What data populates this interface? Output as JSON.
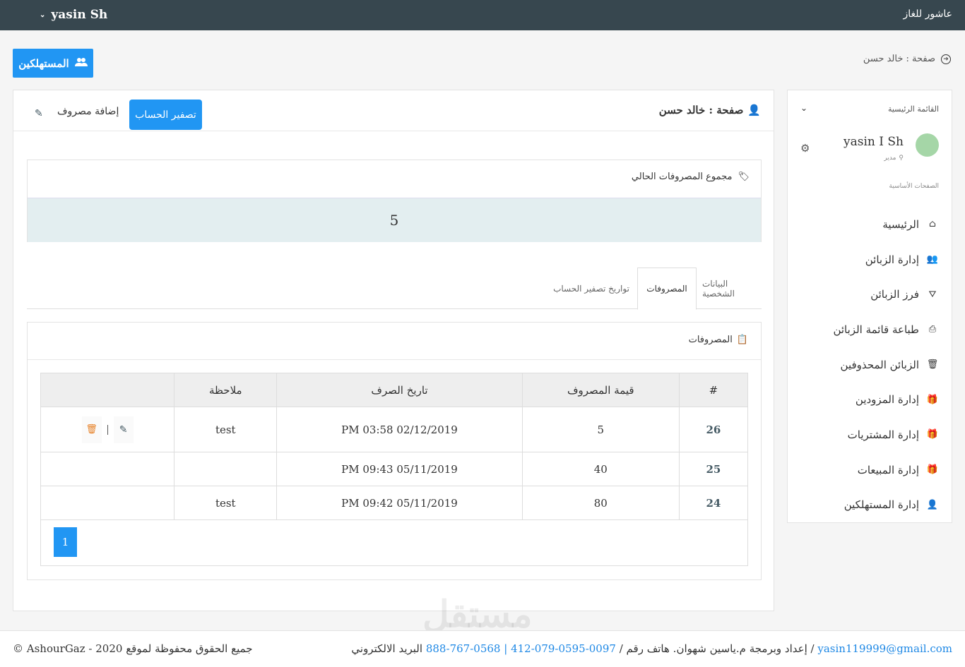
{
  "topbar": {
    "brand": "عاشور للغاز",
    "user": "yasin Sh"
  },
  "page": {
    "crumb": "صفحة : خالد حسن",
    "consumers_btn": "المستهلكين"
  },
  "sidebar": {
    "menu_title": "القائمة الرئيسية",
    "user_name": "yasin I Sh",
    "user_role": "مدير",
    "section_title": "الصفحات الأساسية",
    "items": [
      {
        "label": "الرئيسية",
        "icon": "home-icon"
      },
      {
        "label": "إدارة الزبائن",
        "icon": "users-icon"
      },
      {
        "label": "فرز الزبائن",
        "icon": "filter-icon"
      },
      {
        "label": "طباعة قائمة الزبائن",
        "icon": "print-icon"
      },
      {
        "label": "الزبائن المحذوفين",
        "icon": "trash-icon"
      },
      {
        "label": "إدارة المزودين",
        "icon": "gift-icon"
      },
      {
        "label": "إدارة المشتريات",
        "icon": "gift-icon"
      },
      {
        "label": "إدارة المبيعات",
        "icon": "gift-icon"
      },
      {
        "label": "إدارة المستهلكين",
        "icon": "user-icon"
      }
    ]
  },
  "main": {
    "title": "صفحة : خالد حسن",
    "reset_btn": "تصفير الحساب",
    "add_btn": "إضافة مصروف",
    "sum_label": "مجموع المصروفات الحالي",
    "sum_value": "5",
    "tabs": [
      "البيانات الشخصية",
      "المصروفات",
      "تواريخ تصفير الحساب"
    ],
    "active_tab": 1,
    "expenses_title": "المصروفات",
    "table": {
      "headers": [
        "#",
        "قيمة المصروف",
        "تاريخ الصرف",
        "ملاحظة",
        ""
      ],
      "rows": [
        {
          "id": "26",
          "amount": "5",
          "date": "PM 03:58 02/12/2019",
          "note": "test"
        },
        {
          "id": "25",
          "amount": "40",
          "date": "PM 09:43 05/11/2019",
          "note": ""
        },
        {
          "id": "24",
          "amount": "80",
          "date": "PM 09:42 05/11/2019",
          "note": "test"
        }
      ]
    },
    "page": "1"
  },
  "footer": {
    "copyright": "© AshourGaz - 2020 جميع الحقوق محفوظة لموقع",
    "credits_prefix": "إعداد وبرمجة م.ياسين شهوان. هاتف رقم /",
    "phone": "0097-0595-079-412 | 0568-767-888",
    "email_label": "البريد الالكتروني /",
    "email": "yasin119999@gmail.com"
  },
  "watermark": "مستقل",
  "colors": {
    "topbar": "#37474f",
    "primary": "#2196f3",
    "sum_bg": "#e3eef0"
  }
}
